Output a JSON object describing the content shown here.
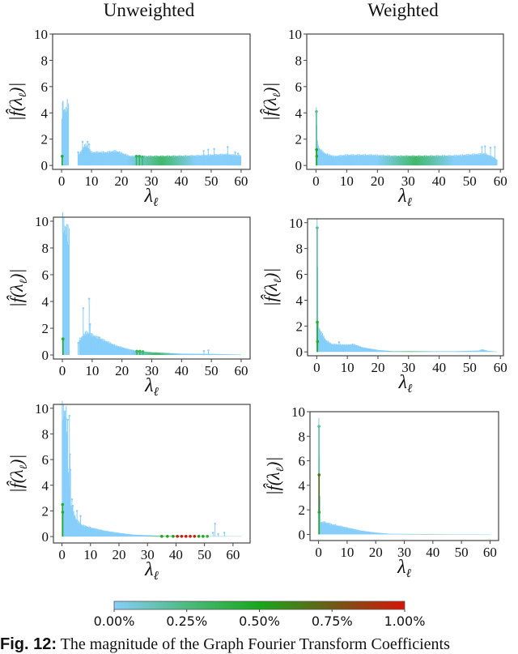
{
  "column_titles": [
    "Unweighted",
    "Weighted"
  ],
  "caption": {
    "label": "Fig. 12:",
    "text": "The magnitude of the Graph Fourier Transform Coefficients"
  },
  "colorbar": {
    "ticks": [
      "0.00%",
      "0.25%",
      "0.50%",
      "0.75%",
      "1.00%"
    ],
    "colors": [
      "#87cefa",
      "#4cbb80",
      "#18a81a",
      "#6e5a16",
      "#d81408"
    ]
  },
  "chart_data": [
    {
      "type": "stem",
      "panel": "row1-unweighted",
      "xlabel": "λ_ℓ",
      "ylabel": "|f̂(λ_ℓ)|",
      "xlim": [
        -3,
        63
      ],
      "ylim": [
        -0.3,
        10
      ],
      "xticks": [
        0,
        10,
        20,
        30,
        40,
        50,
        60
      ],
      "yticks": [
        0,
        2,
        4,
        6,
        8,
        10
      ],
      "profile": [
        [
          0.1,
          3.3
        ],
        [
          0.3,
          5.2
        ],
        [
          0.6,
          4.4
        ],
        [
          1.0,
          4.2
        ],
        [
          1.5,
          4.2
        ],
        [
          2.0,
          4.8
        ],
        [
          2.4,
          4.3
        ]
      ],
      "segments": [
        [
          6,
          0.9
        ],
        [
          8,
          1.6
        ],
        [
          10,
          1.0
        ],
        [
          15,
          1.0
        ],
        [
          18,
          1.1
        ],
        [
          20,
          0.95
        ],
        [
          23,
          0.7
        ],
        [
          30,
          0.7
        ],
        [
          40,
          0.72
        ],
        [
          45,
          0.75
        ],
        [
          50,
          0.8
        ],
        [
          55,
          0.85
        ],
        [
          60,
          0.75
        ]
      ],
      "spikes": [
        [
          5.5,
          1.0
        ],
        [
          7,
          1.8
        ],
        [
          8.7,
          1.8
        ],
        [
          9.2,
          1.6
        ],
        [
          47.5,
          1.1
        ],
        [
          49,
          1.2
        ],
        [
          51,
          1.25
        ],
        [
          55.5,
          1.4
        ],
        [
          58,
          1.0
        ],
        [
          59,
          0.9
        ]
      ],
      "highlight": [
        [
          0.2,
          0.7,
          0.45
        ],
        [
          25,
          0.7,
          0.35
        ],
        [
          26,
          0.7,
          0.35
        ],
        [
          27,
          0.65,
          0.3
        ]
      ],
      "gradient_range": [
        22,
        45
      ],
      "gradient_pct": 0.3
    },
    {
      "type": "stem",
      "panel": "row1-weighted",
      "xlabel": "λ_ℓ",
      "ylabel": "|f̂(λ_ℓ)|",
      "xlim": [
        -3,
        61
      ],
      "ylim": [
        -0.3,
        10
      ],
      "xticks": [
        0,
        10,
        20,
        30,
        40,
        50,
        60
      ],
      "yticks": [
        0,
        2,
        4,
        6,
        8,
        10
      ],
      "profile": [
        [
          0.2,
          4.1
        ],
        [
          0.5,
          1.8
        ],
        [
          1,
          1.3
        ],
        [
          3,
          0.9
        ],
        [
          6,
          0.7
        ],
        [
          10,
          0.8
        ],
        [
          18,
          0.8
        ],
        [
          25,
          0.72
        ],
        [
          35,
          0.72
        ],
        [
          45,
          0.75
        ],
        [
          52,
          0.85
        ],
        [
          55,
          0.9
        ],
        [
          58,
          0.6
        ],
        [
          59,
          0.4
        ]
      ],
      "segments": [],
      "spikes": [
        [
          54,
          1.4
        ],
        [
          55,
          1.45
        ],
        [
          56.8,
          1.35
        ],
        [
          58.2,
          1.4
        ]
      ],
      "highlight": [
        [
          0.15,
          4.1,
          0.2
        ],
        [
          0.2,
          1.2,
          0.5
        ],
        [
          0.25,
          0.7,
          0.45
        ]
      ],
      "gradient_range": [
        20,
        45
      ],
      "gradient_pct": 0.3
    },
    {
      "type": "stem",
      "panel": "row2-unweighted",
      "xlabel": "λ_ℓ",
      "ylabel": "|f̂(λ_ℓ)|",
      "xlim": [
        -3,
        63
      ],
      "ylim": [
        -0.3,
        10.3
      ],
      "xticks": [
        0,
        10,
        20,
        30,
        40,
        50,
        60
      ],
      "yticks": [
        0,
        2,
        4,
        6,
        8,
        10
      ],
      "profile": [
        [
          0.2,
          9.9
        ],
        [
          1,
          9.5
        ],
        [
          2,
          9.0
        ],
        [
          2.4,
          8.8
        ]
      ],
      "segments": [
        [
          6,
          1.2
        ],
        [
          8,
          1.7
        ],
        [
          10,
          1.5
        ],
        [
          14,
          1.1
        ],
        [
          18,
          0.7
        ],
        [
          22,
          0.45
        ],
        [
          25,
          0.3
        ],
        [
          30,
          0.2
        ],
        [
          40,
          0.1
        ],
        [
          50,
          0.08
        ],
        [
          60,
          0.03
        ]
      ],
      "spikes": [
        [
          5.3,
          0.9
        ],
        [
          7,
          3.5
        ],
        [
          9,
          4.2
        ],
        [
          9.3,
          2.3
        ],
        [
          12.5,
          1.3
        ],
        [
          47.5,
          0.3
        ],
        [
          49,
          0.35
        ]
      ],
      "highlight": [
        [
          0.2,
          1.2,
          0.45
        ],
        [
          25,
          0.28,
          0.35
        ],
        [
          26,
          0.28,
          0.35
        ],
        [
          27,
          0.25,
          0.3
        ]
      ],
      "gradient_range": [
        23,
        40
      ],
      "gradient_pct": 0.3
    },
    {
      "type": "stem",
      "panel": "row2-weighted",
      "xlabel": "λ_ℓ",
      "ylabel": "|f̂(λ_ℓ)|",
      "xlim": [
        -3,
        61
      ],
      "ylim": [
        -0.3,
        10.3
      ],
      "xticks": [
        0,
        10,
        20,
        30,
        40,
        50,
        60
      ],
      "yticks": [
        0,
        2,
        4,
        6,
        8,
        10
      ],
      "profile": [
        [
          0.2,
          9.6
        ],
        [
          0.5,
          2.1
        ],
        [
          1,
          1.7
        ],
        [
          3,
          0.9
        ],
        [
          5,
          0.6
        ],
        [
          10,
          0.55
        ],
        [
          12,
          0.6
        ],
        [
          15,
          0.35
        ],
        [
          20,
          0.15
        ],
        [
          25,
          0.05
        ],
        [
          30,
          0.05
        ],
        [
          45,
          0.05
        ],
        [
          53,
          0.1
        ],
        [
          54,
          0.2
        ],
        [
          56,
          0.08
        ],
        [
          59,
          0.02
        ]
      ],
      "segments": [],
      "spikes": [
        [
          7.3,
          0.75
        ]
      ],
      "highlight": [
        [
          0.15,
          9.6,
          0.2
        ],
        [
          0.2,
          2.3,
          0.45
        ],
        [
          0.25,
          0.8,
          0.45
        ]
      ],
      "gradient_range": [
        21,
        40
      ],
      "gradient_pct": 0.3
    },
    {
      "type": "stem",
      "panel": "row3-unweighted",
      "xlabel": "λ_ℓ",
      "ylabel": "|f̂(λ_ℓ)|",
      "xlim": [
        -3,
        66
      ],
      "ylim": [
        -0.5,
        10.3
      ],
      "xticks": [
        0,
        10,
        20,
        30,
        40,
        50,
        60
      ],
      "yticks": [
        0,
        2,
        4,
        6,
        8,
        10
      ],
      "profile": [
        [
          0.2,
          9.8
        ],
        [
          1,
          9.7
        ],
        [
          1.6,
          9.6
        ],
        [
          2.2,
          5.0
        ],
        [
          3,
          2.5
        ],
        [
          5,
          1.3
        ],
        [
          7,
          0.9
        ],
        [
          10,
          0.7
        ],
        [
          15,
          0.45
        ],
        [
          20,
          0.28
        ],
        [
          25,
          0.15
        ],
        [
          30,
          0.1
        ],
        [
          35,
          0.05
        ],
        [
          50,
          0.03
        ],
        [
          63,
          0.02
        ]
      ],
      "segments": [],
      "spikes": [
        [
          2.0,
          9.1
        ],
        [
          2.6,
          9.4
        ],
        [
          2.8,
          6.4
        ],
        [
          3.0,
          5.2
        ],
        [
          3.5,
          2.9
        ],
        [
          3.8,
          2.4
        ],
        [
          4.5,
          1.5
        ],
        [
          5.3,
          2.0
        ],
        [
          6.5,
          1.6
        ],
        [
          53,
          0.3
        ],
        [
          53.7,
          1.0
        ],
        [
          54.8,
          0.2
        ],
        [
          57,
          0.3
        ]
      ],
      "highlight": [
        [
          0.2,
          2.5,
          0.45
        ],
        [
          0.25,
          1.9,
          0.45
        ],
        [
          35,
          0.02,
          0.5
        ],
        [
          37,
          0.02,
          0.5
        ],
        [
          39,
          0.02,
          0.55
        ],
        [
          40.5,
          0.02,
          0.95
        ],
        [
          42,
          0.02,
          1.0
        ],
        [
          43.5,
          0.02,
          1.0
        ],
        [
          45,
          0.02,
          1.0
        ],
        [
          46.5,
          0.02,
          0.95
        ],
        [
          48,
          0.02,
          0.55
        ],
        [
          49.5,
          0.02,
          0.5
        ],
        [
          51,
          0.02,
          0.4
        ]
      ],
      "gradient_range": [
        28,
        52
      ],
      "gradient_pct": 0.35
    },
    {
      "type": "stem",
      "panel": "row3-weighted",
      "xlabel": "λ_ℓ",
      "ylabel": "|f̂(λ_ℓ)|",
      "xlim": [
        -3,
        63
      ],
      "ylim": [
        -0.5,
        10
      ],
      "xticks": [
        0,
        10,
        20,
        30,
        40,
        50,
        60
      ],
      "yticks": [
        0,
        2,
        4,
        6,
        8,
        10
      ],
      "profile": [
        [
          0.2,
          8.8
        ],
        [
          0.6,
          1.0
        ],
        [
          2,
          1.0
        ],
        [
          5,
          0.8
        ],
        [
          10,
          0.55
        ],
        [
          15,
          0.3
        ],
        [
          20,
          0.15
        ],
        [
          25,
          0.05
        ],
        [
          35,
          0.03
        ],
        [
          50,
          0.03
        ],
        [
          60,
          0.02
        ]
      ],
      "segments": [],
      "spikes": [],
      "highlight": [
        [
          0.15,
          8.8,
          0.2
        ],
        [
          0.18,
          4.85,
          0.7
        ],
        [
          0.2,
          1.8,
          0.45
        ]
      ],
      "gradient_range": [
        28,
        48
      ],
      "gradient_pct": 0.3
    }
  ]
}
